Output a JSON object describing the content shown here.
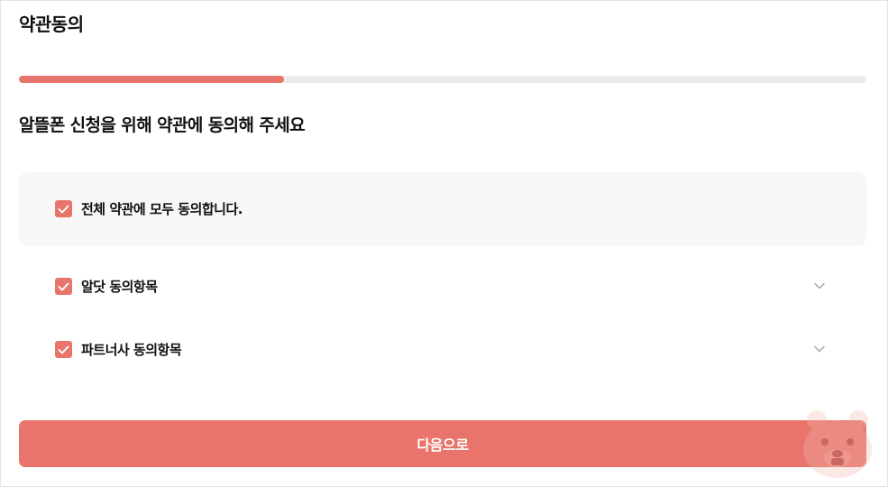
{
  "header": {
    "title": "약관동의"
  },
  "progress": {
    "percent": 31.3,
    "fill_color": "#e8756c",
    "track_color": "#ececec"
  },
  "main": {
    "subtitle": "알뜰폰 신청을 위해 약관에 동의해 주세요",
    "all_agree": {
      "label": "전체 약관에 모두 동의합니다.",
      "checked": true
    },
    "agreements": [
      {
        "label": "알닷 동의항목",
        "checked": true,
        "expand_icon": "chevron-down-icon"
      },
      {
        "label": "파트너사 동의항목",
        "checked": true,
        "expand_icon": "chevron-down-icon"
      }
    ],
    "next_button_label": "다음으로"
  },
  "colors": {
    "accent": "#e8756c",
    "panel": "#f7f7f7",
    "text": "#111111",
    "chevron": "#a8a8a8"
  },
  "icons": {
    "checkbox": "check-icon",
    "expand": "chevron-down-icon",
    "mascot": "bear-mascot-icon"
  }
}
